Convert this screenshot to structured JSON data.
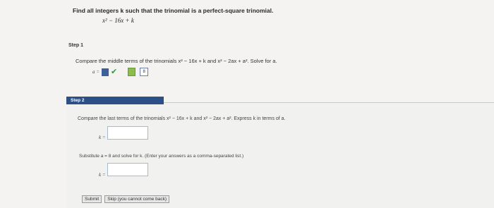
{
  "problem": {
    "title": "Find all integers k such that the trinomial is a perfect-square trinomial.",
    "trinomial": "x² − 16x + k"
  },
  "step1": {
    "label": "Step 1",
    "instruction": "Compare the middle terms of the trinomials x² − 16x + k and x² − 2ax + a². Solve for a.",
    "answer_label": "a =",
    "answer_value": "8"
  },
  "step2": {
    "label": "Step 2",
    "instruction": "Compare the last terms of the trinomials x² − 16x + k and x² − 2ax + a². Express k in terms of a.",
    "k_label": "k =",
    "k_value": "",
    "substitute_text": "Substitute a = 8 and solve for k. (Enter your answers as a comma-separated list.)",
    "k2_label": "k =",
    "k2_value": ""
  },
  "buttons": {
    "submit": "Submit",
    "skip": "Skip (you cannot come back)"
  }
}
